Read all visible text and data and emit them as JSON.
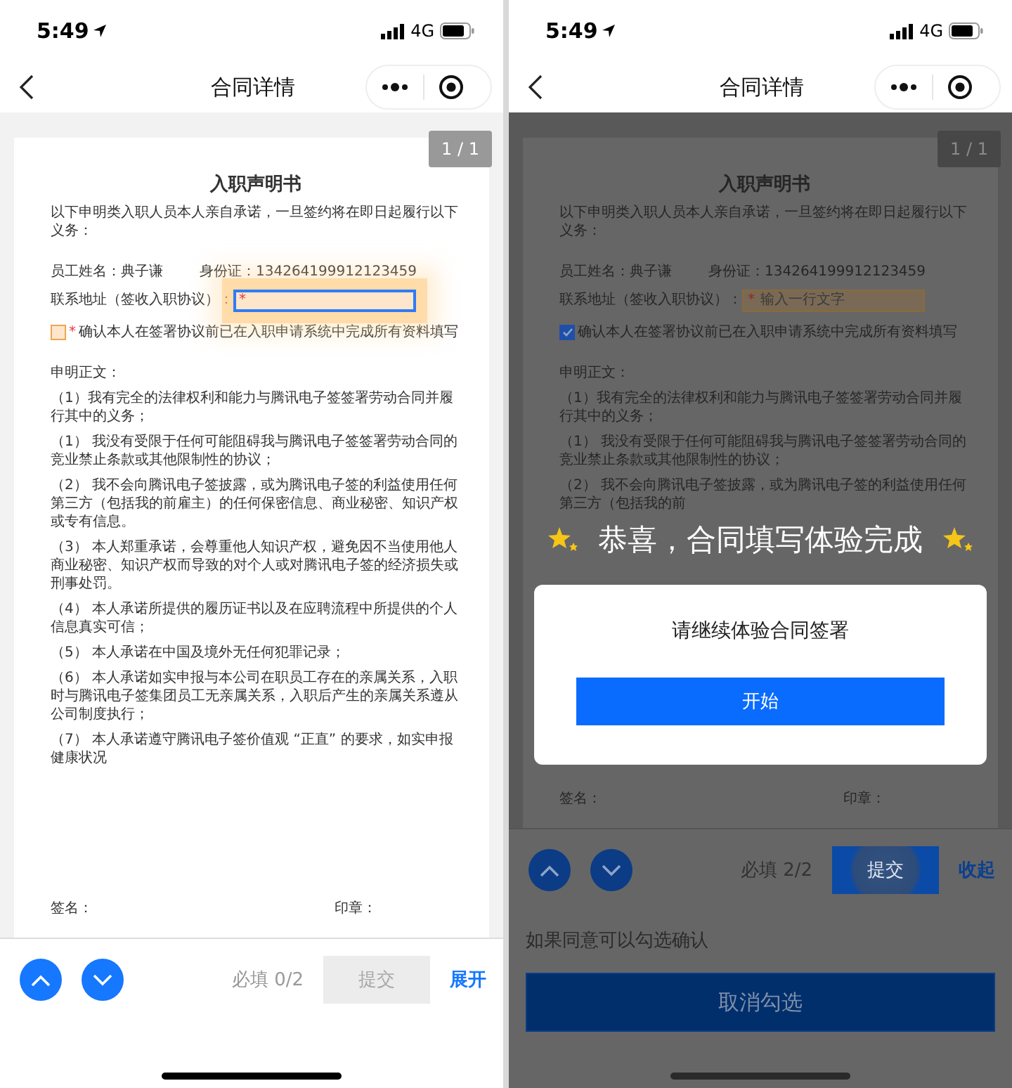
{
  "screens": [
    {
      "dimmed": false,
      "status_bar": {
        "time": "5:49",
        "network": "4G"
      },
      "nav": {
        "title": "合同详情"
      },
      "page_indicator": "1 / 1",
      "document": {
        "title": "入职声明书",
        "intro": "以下申明类入职人员本人亲自承诺，一旦签约将在即日起履行以下义务：",
        "employee_name": "员工姓名：典子谦",
        "id_number": "身份证：134264199912123459",
        "address_label": "联系地址（签收入职协议）：",
        "address_field": {
          "required_mark": "*",
          "focused": true,
          "touched": true
        },
        "confirm": {
          "required_mark": "*",
          "checked": false,
          "label": "确认本人在签署协议前已在入职申请系统中完成所有资料填写"
        },
        "body_heading": "申明正文：",
        "clauses": [
          "（1）我有完全的法律权利和能力与腾讯电子签签署劳动合同并履行其中的义务；",
          "（1） 我没有受限于任何可能阻碍我与腾讯电子签签署劳动合同的竞业禁止条款或其他限制性的协议；",
          "（2） 我不会向腾讯电子签披露，或为腾讯电子签的利益使用任何第三方（包括我的前雇主）的任何保密信息、商业秘密、知识产权或专有信息。",
          "（3） 本人郑重承诺，会尊重他人知识产权，避免因不当使用他人商业秘密、知识产权而导致的对个人或对腾讯电子签的经济损失或刑事处罚。",
          "（4） 本人承诺所提供的履历证书以及在应聘流程中所提供的个人信息真实可信；",
          "（5） 本人承诺在中国及境外无任何犯罪记录；",
          "（6） 本人承诺如实申报与本公司在职员工存在的亲属关系，入职时与腾讯电子签集团员工无亲属关系，入职后产生的亲属关系遵从公司制度执行；",
          "（7） 本人承诺遵守腾讯电子签价值观 “正直” 的要求，如实申报健康状况"
        ],
        "signature": "签名：",
        "seal": "印章："
      },
      "toolbar": {
        "required": "必填 0/2",
        "submit": {
          "label": "提交",
          "disabled": true,
          "touched": false
        },
        "toggle": "展开"
      }
    },
    {
      "dimmed": true,
      "status_bar": {
        "time": "5:49",
        "network": "4G"
      },
      "nav": {
        "title": "合同详情"
      },
      "page_indicator": "1 / 1",
      "document": {
        "title": "入职声明书",
        "intro": "以下申明类入职人员本人亲自承诺，一旦签约将在即日起履行以下义务：",
        "employee_name": "员工姓名：典子谦",
        "id_number": "身份证：134264199912123459",
        "address_label": "联系地址（签收入职协议）：",
        "address_field": {
          "required_mark": "*",
          "placeholder": "输入一行文字",
          "focused": false,
          "touched": false
        },
        "confirm": {
          "checked": true,
          "label": "确认本人在签署协议前已在入职申请系统中完成所有资料填写"
        },
        "body_heading": "申明正文：",
        "clauses": [
          "（1）我有完全的法律权利和能力与腾讯电子签签署劳动合同并履行其中的义务；",
          "（1） 我没有受限于任何可能阻碍我与腾讯电子签签署劳动合同的竞业禁止条款或其他限制性的协议；",
          "（2） 我不会向腾讯电子签披露，或为腾讯电子签的利益使用任何第三方（包括我的前"
        ],
        "signature": "签名：",
        "seal": "印章："
      },
      "popup": {
        "congrats": "恭喜，合同填写体验完成",
        "message": "请继续体验合同签署",
        "button": "开始"
      },
      "toolbar": {
        "required": "必填 2/2",
        "submit": {
          "label": "提交",
          "disabled": false,
          "touched": true
        },
        "toggle": "收起"
      },
      "agreement": {
        "hint": "如果同意可以勾选确认",
        "button": "取消勾选"
      }
    }
  ]
}
